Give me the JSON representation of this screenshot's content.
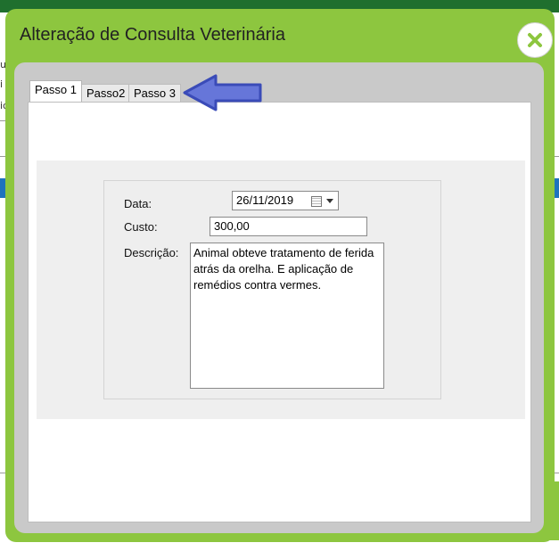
{
  "modal": {
    "title": "Alteração de Consulta Veterinária",
    "close_icon": "close-x-icon"
  },
  "tabs": [
    {
      "label": "Passo 1",
      "active": true
    },
    {
      "label": "Passo2",
      "active": false
    },
    {
      "label": "Passo 3",
      "active": false
    }
  ],
  "annotation": {
    "icon": "arrow-left-icon",
    "color": "#5b6fd6"
  },
  "form": {
    "date_label": "Data:",
    "date_value": "26/11/2019",
    "cost_label": "Custo:",
    "cost_value": "300,00",
    "description_label": "Descrição:",
    "description_value": "Animal obteve tratamento de ferida atrás da orelha. E aplicação de remédios contra vermes."
  },
  "background": {
    "left_chars": [
      "u",
      "i",
      "ic"
    ]
  },
  "colors": {
    "modal_header": "#8dc63f",
    "top_bar": "#1f6f2e",
    "close_icon": "#8dc63f"
  }
}
